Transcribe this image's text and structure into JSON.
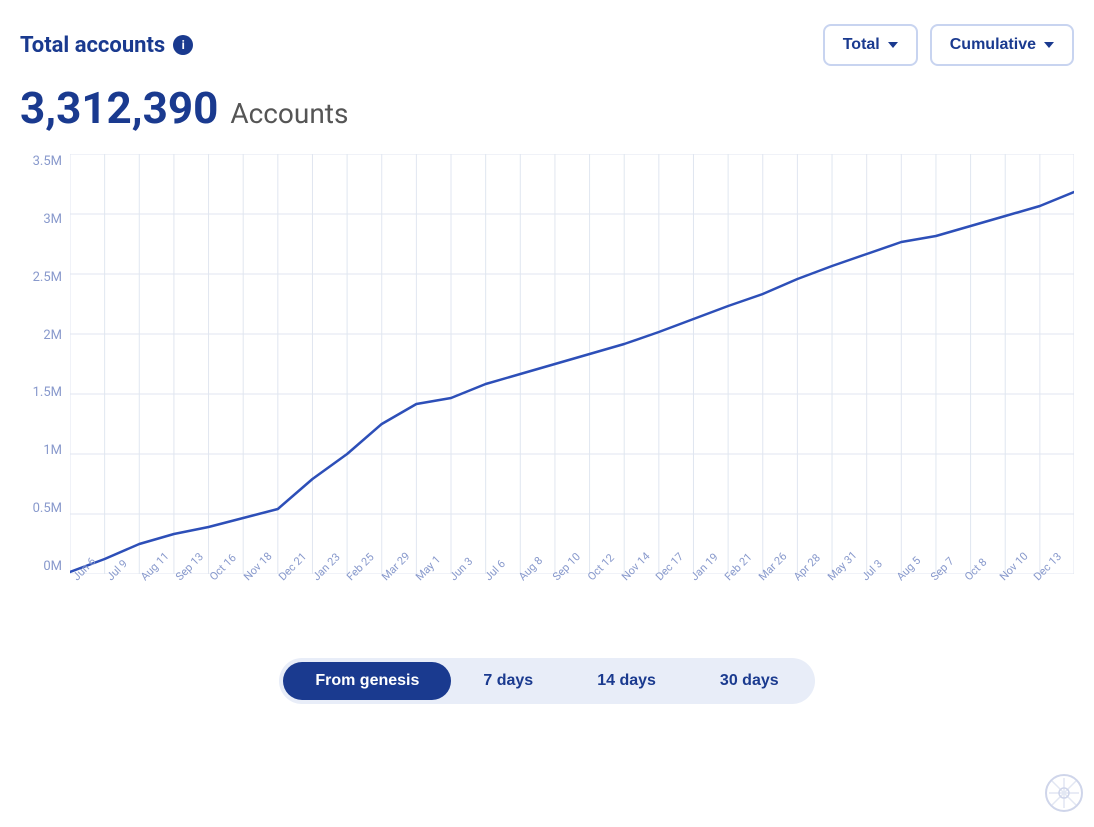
{
  "header": {
    "title": "Total accounts",
    "info_icon_label": "i"
  },
  "controls": {
    "dropdown1_label": "Total",
    "dropdown2_label": "Cumulative"
  },
  "metric": {
    "value": "3,312,390",
    "unit": "Accounts"
  },
  "y_axis": {
    "labels": [
      "3.5M",
      "3M",
      "2.5M",
      "2M",
      "1.5M",
      "1M",
      "0.5M",
      "0M"
    ]
  },
  "x_axis": {
    "labels": [
      "Jun 6",
      "Jul 9",
      "Aug 11",
      "Sep 13",
      "Oct 16",
      "Nov 18",
      "Dec 21",
      "Jan 23",
      "Feb 25",
      "Mar 29",
      "May 1",
      "Jun 3",
      "Jul 6",
      "Aug 8",
      "Sep 10",
      "Oct 12",
      "Nov 14",
      "Dec 17",
      "Jan 19",
      "Feb 21",
      "Mar 26",
      "Apr 28",
      "May 31",
      "Jul 3",
      "Aug 5",
      "Sep 7",
      "Oct 8",
      "Nov 10",
      "Dec 13"
    ]
  },
  "time_filters": [
    {
      "label": "From genesis",
      "active": true
    },
    {
      "label": "7 days",
      "active": false
    },
    {
      "label": "14 days",
      "active": false
    },
    {
      "label": "30 days",
      "active": false
    }
  ],
  "colors": {
    "primary": "#1a3a8f",
    "line": "#2d4fb8",
    "grid": "#e0e6f0",
    "active_filter_bg": "#1a3a8f",
    "inactive_filter_bg": "#e8edf8"
  }
}
